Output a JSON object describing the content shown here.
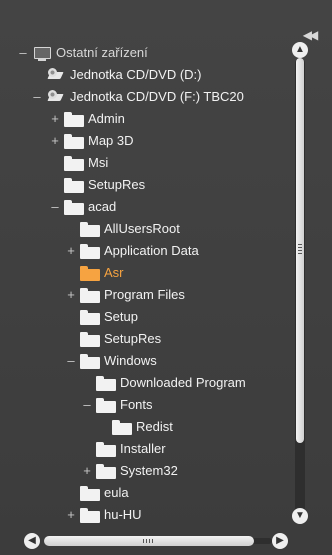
{
  "panel": {
    "collapse_icon": "double-chevron-left-icon"
  },
  "tree": {
    "nodes": [
      {
        "label": "Ostatní zařízení",
        "toggle": "–",
        "icon": "computer-icon"
      },
      {
        "label": "Jednotka CD/DVD (D:)",
        "toggle": "",
        "icon": "cd-drive-icon"
      },
      {
        "label": "Jednotka CD/DVD (F:) TBC20",
        "toggle": "–",
        "icon": "cd-drive-icon"
      },
      {
        "label": "Admin",
        "toggle": "+",
        "icon": "folder-icon"
      },
      {
        "label": "Map 3D",
        "toggle": "+",
        "icon": "folder-icon"
      },
      {
        "label": "Msi",
        "toggle": "",
        "icon": "folder-icon"
      },
      {
        "label": "SetupRes",
        "toggle": "",
        "icon": "folder-icon"
      },
      {
        "label": "acad",
        "toggle": "–",
        "icon": "folder-icon"
      },
      {
        "label": "AllUsersRoot",
        "toggle": "",
        "icon": "folder-icon"
      },
      {
        "label": "Application Data",
        "toggle": "+",
        "icon": "folder-icon"
      },
      {
        "label": "Asr",
        "toggle": "",
        "icon": "folder-icon",
        "selected": true
      },
      {
        "label": "Program Files",
        "toggle": "+",
        "icon": "folder-icon"
      },
      {
        "label": "Setup",
        "toggle": "",
        "icon": "folder-icon"
      },
      {
        "label": "SetupRes",
        "toggle": "",
        "icon": "folder-icon"
      },
      {
        "label": "Windows",
        "toggle": "–",
        "icon": "folder-icon"
      },
      {
        "label": "Downloaded Program",
        "toggle": "",
        "icon": "folder-icon"
      },
      {
        "label": "Fonts",
        "toggle": "–",
        "icon": "folder-icon"
      },
      {
        "label": "Redist",
        "toggle": "",
        "icon": "folder-icon"
      },
      {
        "label": "Installer",
        "toggle": "",
        "icon": "folder-icon"
      },
      {
        "label": "System32",
        "toggle": "+",
        "icon": "folder-icon"
      },
      {
        "label": "eula",
        "toggle": "",
        "icon": "folder-icon"
      },
      {
        "label": "hu-HU",
        "toggle": "+",
        "icon": "folder-icon"
      }
    ]
  },
  "scrollbars": {
    "vertical": {
      "up_icon": "chevron-up-icon",
      "down_icon": "chevron-down-icon",
      "position": 0.0
    },
    "horizontal": {
      "left_icon": "chevron-left-icon",
      "right_icon": "chevron-right-icon",
      "position": 0.0
    }
  }
}
